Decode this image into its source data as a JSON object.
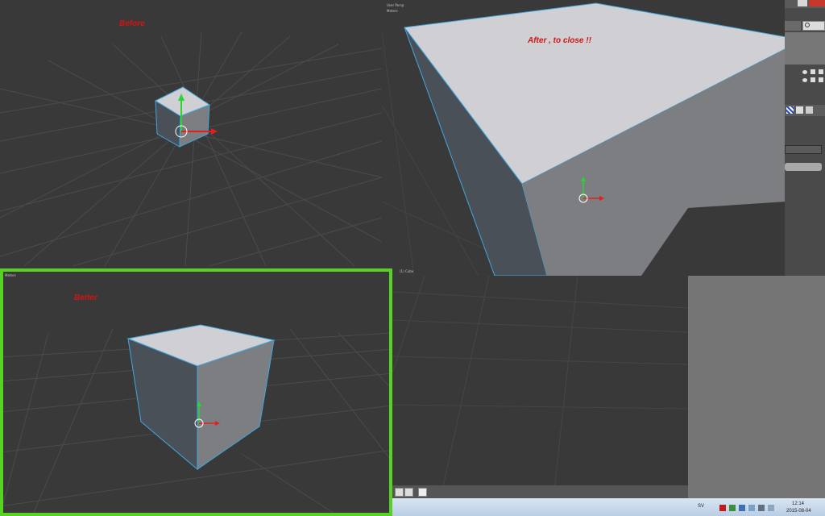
{
  "labels": {
    "before": "Before",
    "after": "After ,   to close !!",
    "better": "Better"
  },
  "viewport_after": {
    "mode": "User Persp",
    "units": "Meters",
    "object": "(1) Cube"
  },
  "viewport_better": {
    "units": "Meters"
  },
  "taskbar": {
    "language": "SV",
    "time": "12:14",
    "date": "2015-08-04"
  },
  "colors": {
    "viewport_bg": "#393939",
    "grid_line": "#4a4a4a",
    "cube_top": "#d0d0d4",
    "cube_left": "#4a5058",
    "cube_right": "#7c7e82",
    "edge_highlight": "#3fa7e0",
    "highlight_border": "#55d320",
    "label_red": "#d11414"
  }
}
